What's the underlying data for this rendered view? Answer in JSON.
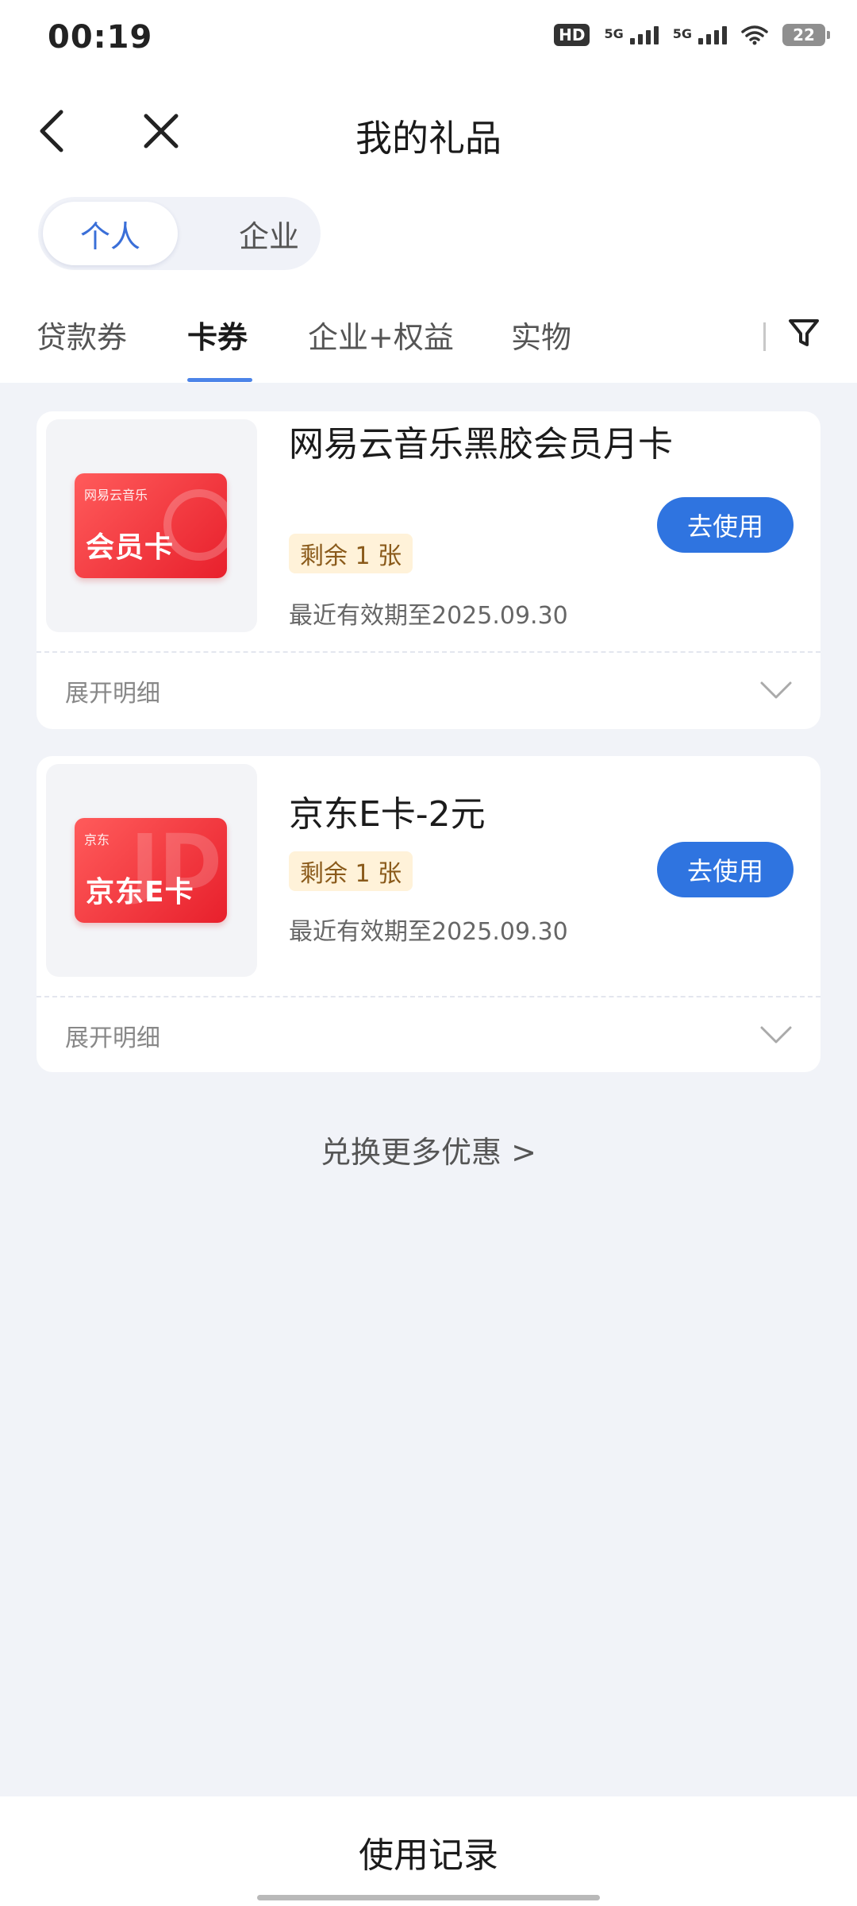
{
  "status_bar": {
    "time": "00:19",
    "hd_label": "HD",
    "network_1": "5G",
    "network_2": "5G",
    "battery": "22"
  },
  "header": {
    "title": "我的礼品"
  },
  "segment": {
    "options": [
      "个人",
      "企业"
    ],
    "selected": "个人"
  },
  "tabs": {
    "items": [
      "贷款券",
      "卡券",
      "企业+权益",
      "实物"
    ],
    "selected": "卡券"
  },
  "cards": [
    {
      "title": "网易云音乐黑胶会员月卡",
      "remaining": "剩余 1 张",
      "expiry": "最近有效期至2025.09.30",
      "action": "去使用",
      "thumb_brand": "网易云音乐",
      "thumb_text": "会员卡",
      "expand_label": "展开明细"
    },
    {
      "title": "京东E卡-2元",
      "remaining": "剩余 1 张",
      "expiry": "最近有效期至2025.09.30",
      "action": "去使用",
      "thumb_brand": "京东",
      "thumb_text": "京东E卡",
      "expand_label": "展开明细"
    }
  ],
  "more_link": "兑换更多优惠 >",
  "bottom": {
    "label": "使用记录"
  },
  "colors": {
    "accent": "#2f74e0",
    "tab_indicator": "#4c84e8",
    "card_red": "#e8202c",
    "chip_bg": "#fff2d9",
    "page_bg": "#f1f3f8"
  }
}
